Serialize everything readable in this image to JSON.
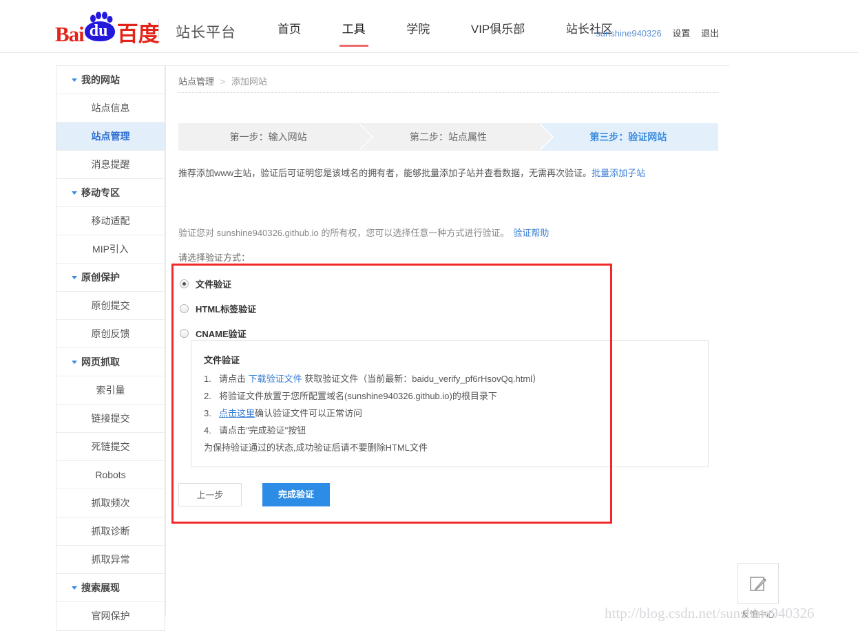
{
  "header": {
    "logo": {
      "bai": "Bai",
      "du": "du",
      "cn": "百度"
    },
    "platform": "站长平台",
    "nav": [
      {
        "label": "首页",
        "active": false
      },
      {
        "label": "工具",
        "active": true
      },
      {
        "label": "学院",
        "active": false
      },
      {
        "label": "VIP俱乐部",
        "active": false
      },
      {
        "label": "站长社区",
        "active": false
      }
    ],
    "user": {
      "name": "sunshine940326",
      "settings": "设置",
      "logout": "退出"
    }
  },
  "sidebar": {
    "groups": [
      {
        "label": "我的网站",
        "items": [
          {
            "label": "站点信息",
            "active": false
          },
          {
            "label": "站点管理",
            "active": true
          },
          {
            "label": "消息提醒",
            "active": false
          }
        ]
      },
      {
        "label": "移动专区",
        "items": [
          {
            "label": "移动适配",
            "active": false
          },
          {
            "label": "MIP引入",
            "active": false
          }
        ]
      },
      {
        "label": "原创保护",
        "items": [
          {
            "label": "原创提交",
            "active": false
          },
          {
            "label": "原创反馈",
            "active": false
          }
        ]
      },
      {
        "label": "网页抓取",
        "items": [
          {
            "label": "索引量",
            "active": false
          },
          {
            "label": "链接提交",
            "active": false
          },
          {
            "label": "死链提交",
            "active": false
          },
          {
            "label": "Robots",
            "active": false
          },
          {
            "label": "抓取频次",
            "active": false
          },
          {
            "label": "抓取诊断",
            "active": false
          },
          {
            "label": "抓取异常",
            "active": false
          }
        ]
      },
      {
        "label": "搜索展现",
        "items": [
          {
            "label": "官网保护",
            "active": false
          }
        ]
      }
    ]
  },
  "main": {
    "breadcrumb": {
      "root": "站点管理",
      "sep": ">",
      "current": "添加网站"
    },
    "description": {
      "text": "推荐添加www主站，验证后可证明您是该域名的拥有者，能够批量添加子站并查看数据，无需再次验证。",
      "link": "批量添加子站"
    },
    "steps": [
      {
        "label": "第一步：输入网站",
        "active": false
      },
      {
        "label": "第二步：站点属性",
        "active": false
      },
      {
        "label": "第三步：验证网站",
        "active": true
      }
    ],
    "ownership": {
      "text": "验证您对 sunshine940326.github.io 的所有权，您可以选择任意一种方式进行验证。",
      "link": "验证帮助"
    },
    "choose_label": "请选择验证方式：",
    "verify_methods": [
      {
        "label": "文件验证",
        "checked": true
      },
      {
        "label": "HTML标签验证",
        "checked": false
      },
      {
        "label": "CNAME验证",
        "checked": false
      }
    ],
    "info_panel": {
      "title": "文件验证",
      "steps": [
        {
          "num": "1.",
          "pre": "请点击 ",
          "link": "下载验证文件",
          "post": " 获取验证文件（当前最新：baidu_verify_pf6rHsovQq.html）"
        },
        {
          "num": "2.",
          "pre": "将验证文件放置于您所配置域名(sunshine940326.github.io)的根目录下",
          "link": "",
          "post": ""
        },
        {
          "num": "3.",
          "pre": "",
          "link": "点击这里",
          "post": "确认验证文件可以正常访问"
        },
        {
          "num": "4.",
          "pre": "请点击\"完成验证\"按钮",
          "link": "",
          "post": ""
        }
      ],
      "note": "为保持验证通过的状态,成功验证后请不要删除HTML文件"
    },
    "buttons": {
      "prev": "上一步",
      "done": "完成验证"
    }
  },
  "feedback": {
    "icon": "pencil-square-icon",
    "label": "反馈中心"
  },
  "watermark": "http://blog.csdn.net/sunshine940326",
  "colors": {
    "brand_red": "#e3241b",
    "brand_blue": "#2319dc",
    "accent_blue": "#2d8ce5",
    "active_nav_underline": "#e96a6a",
    "annotation_red": "#f02a2a",
    "active_sidebar_bg": "#e3eefb"
  }
}
